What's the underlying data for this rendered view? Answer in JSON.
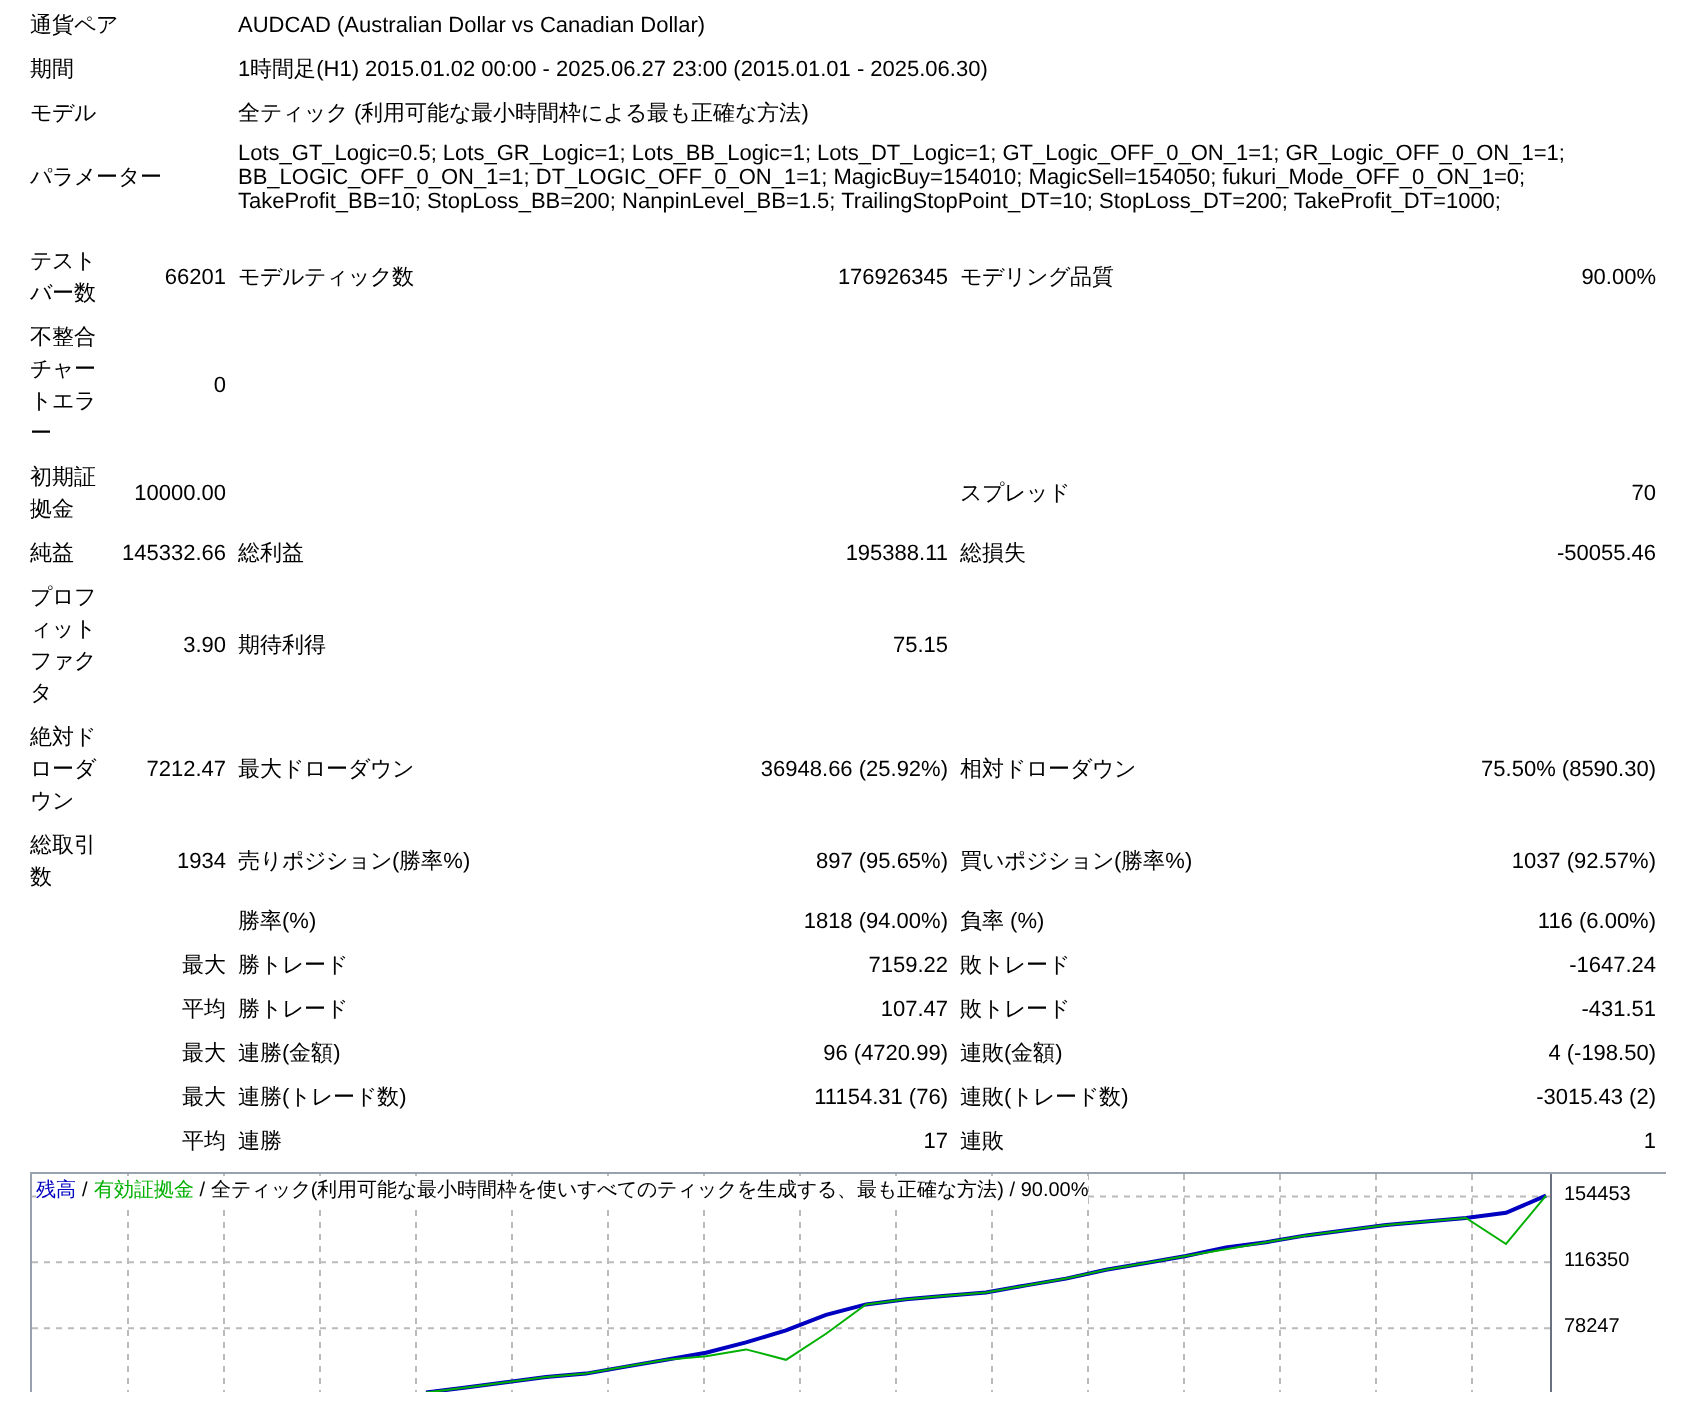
{
  "header": [
    {
      "label": "通貨ペア",
      "value": "AUDCAD (Australian Dollar vs Canadian Dollar)"
    },
    {
      "label": "期間",
      "value": "1時間足(H1) 2015.01.02 00:00 - 2025.06.27 23:00 (2015.01.01 - 2025.06.30)"
    },
    {
      "label": "モデル",
      "value": "全ティック (利用可能な最小時間枠による最も正確な方法)"
    },
    {
      "label": "パラメーター",
      "value": "Lots_GT_Logic=0.5; Lots_GR_Logic=1; Lots_BB_Logic=1; Lots_DT_Logic=1; GT_Logic_OFF_0_ON_1=1; GR_Logic_OFF_0_ON_1=1; BB_LOGIC_OFF_0_ON_1=1; DT_LOGIC_OFF_0_ON_1=1; MagicBuy=154010; MagicSell=154050; fukuri_Mode_OFF_0_ON_1=0; TakeProfit_BB=10; StopLoss_BB=200; NanpinLevel_BB=1.5; TrailingStopPoint_DT=10; StopLoss_DT=200; TakeProfit_DT=1000;"
    }
  ],
  "results": [
    {
      "label": "テストバー数",
      "value": "66201",
      "label2": "モデルティック数",
      "value2": "176926345",
      "label3": "モデリング品質",
      "value3": "90.00%"
    },
    {
      "label": "不整合チャートエラー",
      "value": "0"
    },
    {
      "label": "初期証拠金",
      "value": "10000.00",
      "label3": "スプレッド",
      "value3": "70"
    },
    {
      "label": "純益",
      "value": "145332.66",
      "label2": "総利益",
      "value2": "195388.11",
      "label3": "総損失",
      "value3": "-50055.46"
    },
    {
      "label": "プロフィットファクタ",
      "value": "3.90",
      "label2": "期待利得",
      "value2": "75.15"
    },
    {
      "label": "絶対ドローダウン",
      "value": "7212.47",
      "label2": "最大ドローダウン",
      "value2": "36948.66 (25.92%)",
      "label3": "相対ドローダウン",
      "value3": "75.50% (8590.30)"
    },
    {
      "label": "総取引数",
      "value": "1934",
      "label2": "売りポジション(勝率%)",
      "value2": "897 (95.65%)",
      "label3": "買いポジション(勝率%)",
      "value3": "1037 (92.57%)"
    },
    {
      "label2": "勝率(%)",
      "value2": "1818 (94.00%)",
      "label3": "負率 (%)",
      "value3": "116 (6.00%)"
    },
    {
      "value": "最大",
      "label2": "勝トレード",
      "value2": "7159.22",
      "label3": "敗トレード",
      "value3": "-1647.24"
    },
    {
      "value": "平均",
      "label2": "勝トレード",
      "value2": "107.47",
      "label3": "敗トレード",
      "value3": "-431.51"
    },
    {
      "value": "最大",
      "label2": "連勝(金額)",
      "value2": "96 (4720.99)",
      "label3": "連敗(金額)",
      "value3": "4 (-198.50)"
    },
    {
      "value": "最大",
      "label2": "連勝(トレード数)",
      "value2": "11154.31 (76)",
      "label3": "連敗(トレード数)",
      "value3": "-3015.43 (2)"
    },
    {
      "value": "平均",
      "label2": "連勝",
      "value2": "17",
      "label3": "連敗",
      "value3": "1"
    }
  ],
  "chart": {
    "separator": "/",
    "caption": "/ 全ティック(利用可能な最小時間枠を使いすべてのティックを生成する、最も正確な方法) / 90.00%",
    "chart_data": {
      "type": "line",
      "grid": true,
      "categories": [
        null,
        null,
        null,
        null,
        null,
        null,
        null,
        null,
        null,
        null,
        null,
        null,
        null,
        null,
        null,
        null,
        null,
        null,
        null,
        null,
        null,
        null,
        null,
        null,
        null,
        null,
        null,
        null,
        null
      ],
      "series": [
        {
          "name": "残高",
          "color": "#0000c0",
          "values": [
            41000,
            44000,
            47000,
            50000,
            52000,
            56000,
            60000,
            64000,
            70000,
            77000,
            86000,
            92000,
            95000,
            97000,
            99000,
            103000,
            107000,
            112000,
            116000,
            120000,
            125000,
            128000,
            132000,
            135000,
            138000,
            140000,
            142000,
            145000,
            155000
          ]
        },
        {
          "name": "有効証拠金",
          "color": "#00b000",
          "values": [
            41000,
            44000,
            47000,
            50000,
            52000,
            56000,
            60000,
            62000,
            66000,
            60000,
            75000,
            92000,
            95000,
            97000,
            99000,
            103000,
            107000,
            112000,
            116000,
            120000,
            124000,
            128000,
            132000,
            135000,
            138000,
            140000,
            142000,
            127000,
            155000
          ]
        }
      ],
      "ylim": [
        40145,
        167500
      ],
      "yticks": [
        154453,
        116350,
        78247
      ]
    }
  }
}
